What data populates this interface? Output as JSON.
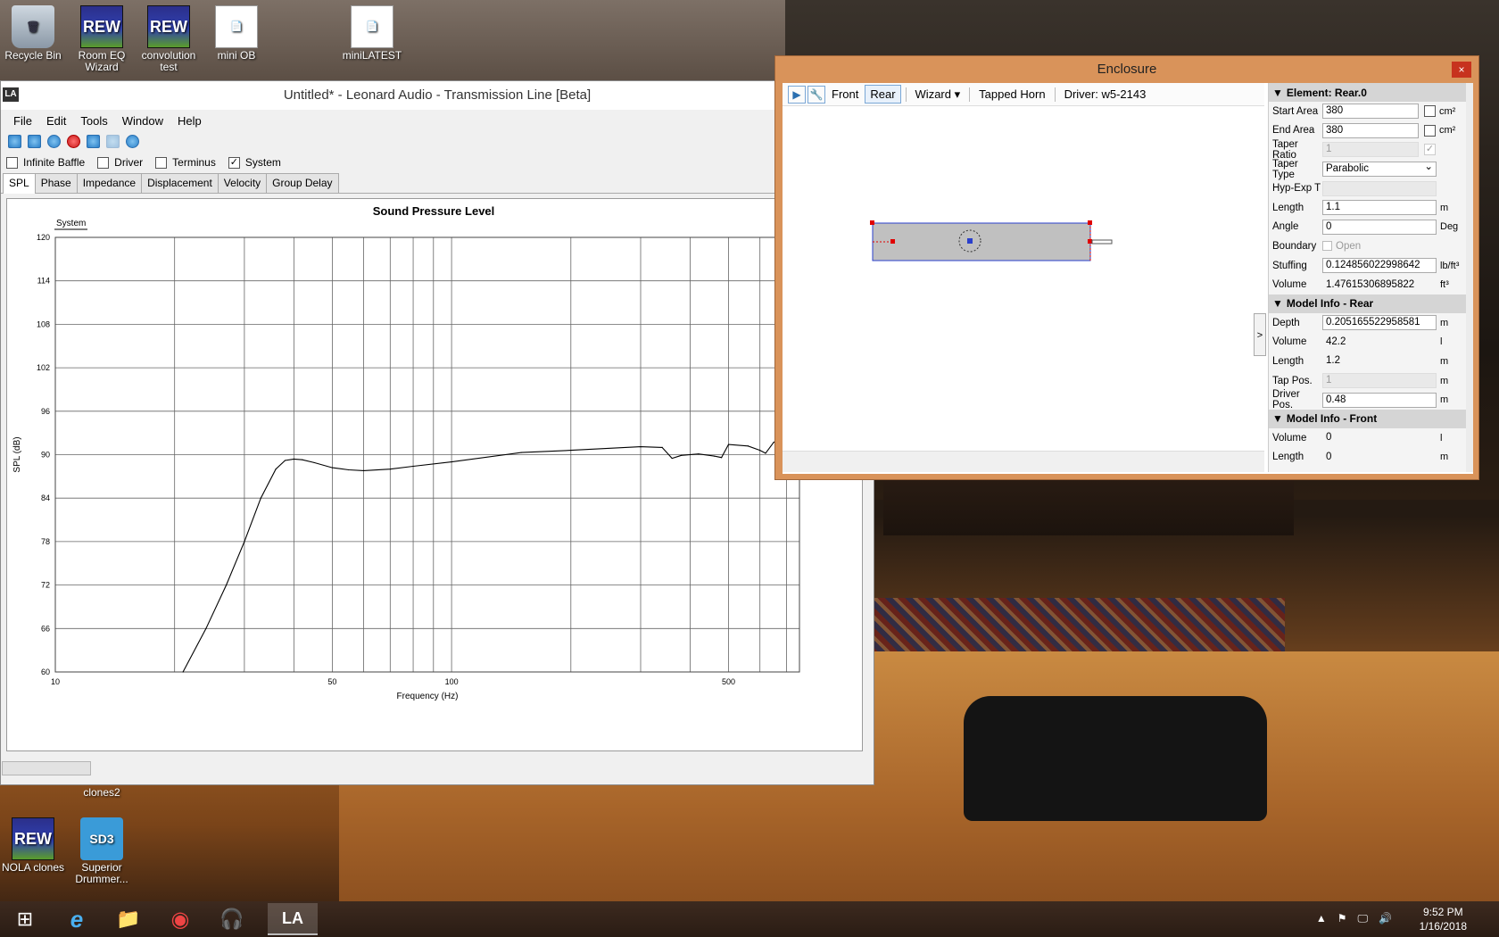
{
  "desktop": {
    "icons": [
      {
        "label": "Recycle Bin",
        "glyph": "🗑"
      },
      {
        "label": "Room EQ Wizard",
        "glyph": "REW"
      },
      {
        "label": "convolution test",
        "glyph": "REW"
      },
      {
        "label": "mini OB",
        "glyph": "📄"
      },
      {
        "label": "miniLATEST",
        "glyph": "📄"
      },
      {
        "label": "clones2",
        "glyph": ""
      },
      {
        "label": "NOLA clones",
        "glyph": "REW"
      },
      {
        "label": "Superior Drummer...",
        "glyph": "SD3"
      }
    ]
  },
  "main_window": {
    "title": "Untitled* - Leonard Audio - Transmission Line [Beta]",
    "app_icon": "LA",
    "menu": [
      "File",
      "Edit",
      "Tools",
      "Window",
      "Help"
    ],
    "checkboxes": [
      {
        "label": "Infinite Baffle",
        "checked": false
      },
      {
        "label": "Driver",
        "checked": false
      },
      {
        "label": "Terminus",
        "checked": false
      },
      {
        "label": "System",
        "checked": true
      }
    ],
    "tabs": [
      "SPL",
      "Phase",
      "Impedance",
      "Displacement",
      "Velocity",
      "Group Delay"
    ],
    "active_tab": "SPL",
    "check_mark": "✓"
  },
  "chart_data": {
    "type": "line",
    "title": "Sound Pressure Level",
    "xlabel": "Frequency (Hz)",
    "ylabel": "SPL (dB)",
    "x_scale": "log",
    "xlim": [
      10,
      1000
    ],
    "ylim": [
      60,
      120
    ],
    "yticks": [
      60,
      66,
      72,
      78,
      84,
      90,
      96,
      102,
      108,
      114,
      120
    ],
    "xtick_labels": [
      {
        "v": 10,
        "t": "10"
      },
      {
        "v": 50,
        "t": "50"
      },
      {
        "v": 100,
        "t": "100"
      },
      {
        "v": 500,
        "t": "500"
      }
    ],
    "grid": true,
    "legend": "top-left",
    "series": [
      {
        "name": "System",
        "color": "#000000",
        "x": [
          21,
          24,
          27,
          30,
          33,
          36,
          38,
          40,
          42,
          45,
          50,
          55,
          60,
          70,
          80,
          100,
          150,
          200,
          300,
          340,
          360,
          380,
          420,
          460,
          480,
          500,
          560,
          600,
          620,
          650,
          680
        ],
        "y": [
          60,
          66,
          72,
          78,
          84,
          88,
          89.2,
          89.4,
          89.3,
          88.9,
          88.2,
          87.9,
          87.8,
          88.0,
          88.4,
          89.0,
          90.3,
          90.6,
          91.1,
          91.0,
          89.5,
          89.9,
          90.1,
          89.8,
          89.6,
          91.4,
          91.2,
          90.6,
          90.2,
          91.7,
          92.3
        ]
      }
    ]
  },
  "enclosure_window": {
    "title": "Enclosure",
    "close_glyph": "×",
    "toolbar": {
      "play_icon": "▶",
      "wrench_icon": "🔧",
      "front": "Front",
      "rear": "Rear",
      "wizard": "Wizard ▾",
      "tapped_horn": "Tapped Horn",
      "driver": "Driver: w5-2143"
    },
    "expander_glyph": ">",
    "sections": [
      {
        "title": "Element: Rear.0",
        "rows": [
          {
            "label": "Start Area",
            "value": "380",
            "unit": "cm²",
            "kind": "input-check"
          },
          {
            "label": "End Area",
            "value": "380",
            "unit": "cm²",
            "kind": "input-check"
          },
          {
            "label": "Taper Ratio",
            "value": "1",
            "unit": "",
            "kind": "disabled-check"
          },
          {
            "label": "Taper Type",
            "value": "Parabolic",
            "unit": "",
            "kind": "select"
          },
          {
            "label": "Hyp-Exp T",
            "value": "",
            "unit": "",
            "kind": "disabled"
          },
          {
            "label": "Length",
            "value": "1.1",
            "unit": "m",
            "kind": "input"
          },
          {
            "label": "Angle",
            "value": "0",
            "unit": "Deg",
            "kind": "input"
          },
          {
            "label": "Boundary",
            "value": "Open",
            "unit": "",
            "kind": "checkbox-text"
          },
          {
            "label": "Stuffing",
            "value": "0.124856022998642",
            "unit": "lb/ft³",
            "kind": "input"
          },
          {
            "label": "Volume",
            "value": "1.47615306895822",
            "unit": "ft³",
            "kind": "readonly"
          }
        ]
      },
      {
        "title": "Model Info - Rear",
        "rows": [
          {
            "label": "Depth",
            "value": "0.205165522958581",
            "unit": "m",
            "kind": "input"
          },
          {
            "label": "Volume",
            "value": "42.2",
            "unit": "l",
            "kind": "readonly"
          },
          {
            "label": "Length",
            "value": "1.2",
            "unit": "m",
            "kind": "readonly"
          },
          {
            "label": "Tap Pos.",
            "value": "1",
            "unit": "m",
            "kind": "disabled"
          },
          {
            "label": "Driver Pos.",
            "value": "0.48",
            "unit": "m",
            "kind": "input"
          }
        ]
      },
      {
        "title": "Model Info - Front",
        "rows": [
          {
            "label": "Volume",
            "value": "0",
            "unit": "l",
            "kind": "readonly"
          },
          {
            "label": "Length",
            "value": "0",
            "unit": "m",
            "kind": "readonly"
          }
        ]
      }
    ]
  },
  "taskbar": {
    "items": [
      {
        "name": "start-button",
        "glyph": "⊞"
      },
      {
        "name": "internet-explorer",
        "glyph": "e"
      },
      {
        "name": "file-explorer",
        "glyph": "📁"
      },
      {
        "name": "chrome",
        "glyph": "◉"
      },
      {
        "name": "audio-app",
        "glyph": "🎧"
      },
      {
        "name": "leonard-audio",
        "glyph": "LA"
      }
    ],
    "tray": [
      "▲",
      "⚑",
      "🖵",
      "🔊"
    ],
    "time": "9:52 PM",
    "date": "1/16/2018"
  },
  "colors": {
    "window_border_enclosure": "#d9935a",
    "selection_blue": "#7aa7d6",
    "enclosure_fill": "#c0c0c0",
    "marker_red": "#e00000"
  }
}
